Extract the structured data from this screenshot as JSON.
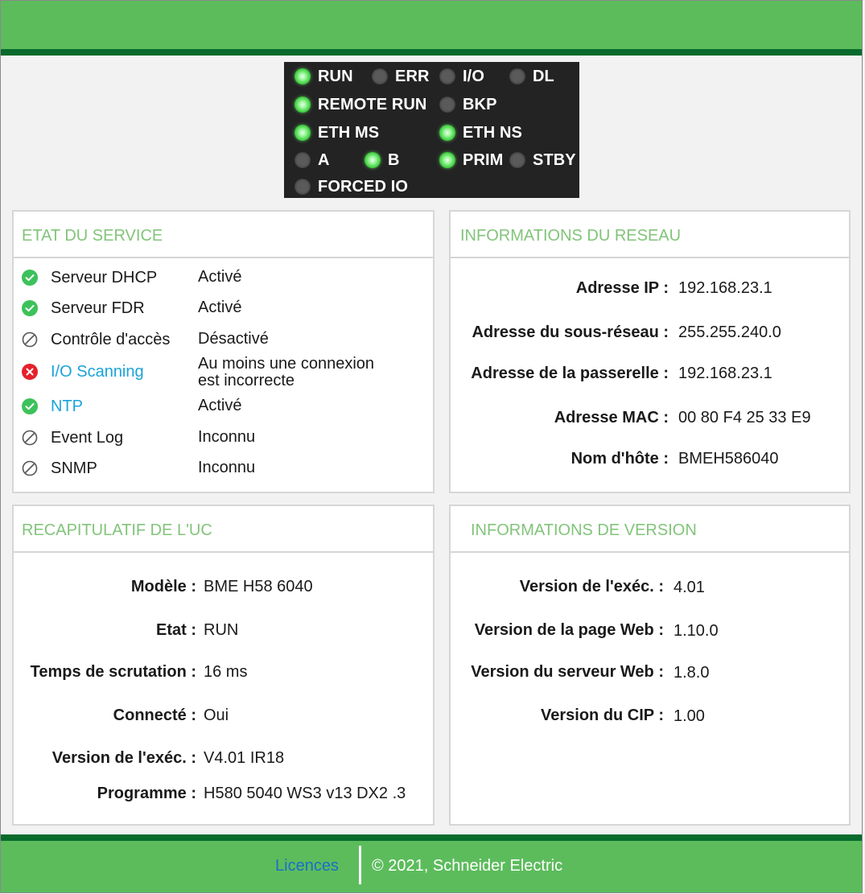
{
  "leds": {
    "run": {
      "label": "RUN",
      "on": true
    },
    "err": {
      "label": "ERR",
      "on": false
    },
    "io": {
      "label": "I/O",
      "on": false
    },
    "dl": {
      "label": "DL",
      "on": false
    },
    "remote_run": {
      "label": "REMOTE RUN",
      "on": true
    },
    "bkp": {
      "label": "BKP",
      "on": false
    },
    "eth_ms": {
      "label": "ETH MS",
      "on": true
    },
    "eth_ns": {
      "label": "ETH NS",
      "on": true
    },
    "a": {
      "label": "A",
      "on": false
    },
    "b": {
      "label": "B",
      "on": true
    },
    "prim": {
      "label": "PRIM",
      "on": true
    },
    "stby": {
      "label": "STBY",
      "on": false
    },
    "forced_io": {
      "label": "FORCED IO",
      "on": false
    }
  },
  "service_state": {
    "title": "ETAT DU SERVICE",
    "rows": [
      {
        "name": "Serveur DHCP",
        "state": "Activé",
        "status": "ok",
        "link": false
      },
      {
        "name": "Serveur FDR",
        "state": "Activé",
        "status": "ok",
        "link": false
      },
      {
        "name": "Contrôle d'accès",
        "state": "Désactivé",
        "status": "disabled",
        "link": false
      },
      {
        "name": "I/O Scanning",
        "state_line1": "Au moins une connexion",
        "state_line2": "est incorrecte",
        "status": "error",
        "link": true
      },
      {
        "name": "NTP",
        "state": "Activé",
        "status": "ok",
        "link": true
      },
      {
        "name": "Event Log",
        "state": "Inconnu",
        "status": "disabled",
        "link": false
      },
      {
        "name": "SNMP",
        "state": "Inconnu",
        "status": "disabled",
        "link": false
      }
    ]
  },
  "network_info": {
    "title": "INFORMATIONS DU RESEAU",
    "ip_label": "Adresse IP :",
    "ip_value": "192.168.23.1",
    "subnet_label": "Adresse du sous-réseau :",
    "subnet_value": "255.255.240.0",
    "gateway_label": "Adresse de la passerelle :",
    "gateway_value": "192.168.23.1",
    "mac_label": "Adresse MAC :",
    "mac_value": "00 80 F4 25 33 E9",
    "hostname_label": "Nom d'hôte :",
    "hostname_value": "BMEH586040"
  },
  "cpu_summary": {
    "title": "RECAPITULATIF DE L'UC",
    "model_label": "Modèle :",
    "model_value": "BME H58 6040",
    "state_label": "Etat :",
    "state_value": "RUN",
    "scan_label": "Temps de scrutation :",
    "scan_value": "16 ms",
    "connected_label": "Connecté :",
    "connected_value": "Oui",
    "exec_label": "Version de l'exéc. :",
    "exec_value": "V4.01 IR18",
    "program_label": "Programme :",
    "program_value": "H580 5040 WS3 v13 DX2 .3"
  },
  "version_info": {
    "title": "INFORMATIONS DE VERSION",
    "exec_label": "Version de l'exéc. :",
    "exec_value": "4.01",
    "webpage_label": "Version de la page Web :",
    "webpage_value": "1.10.0",
    "webserver_label": "Version du serveur Web :",
    "webserver_value": "1.8.0",
    "cip_label": "Version du CIP :",
    "cip_value": "1.00"
  },
  "footer": {
    "licences": "Licences",
    "copyright": "© 2021, Schneider Electric"
  },
  "colors": {
    "header_green": "#5cbc5c",
    "header_dark_stripe": "#086b2c",
    "title_green": "#82c47a",
    "link_blue": "#1aa3d9",
    "ok_green": "#3cc25a",
    "error_red": "#e5202a"
  }
}
